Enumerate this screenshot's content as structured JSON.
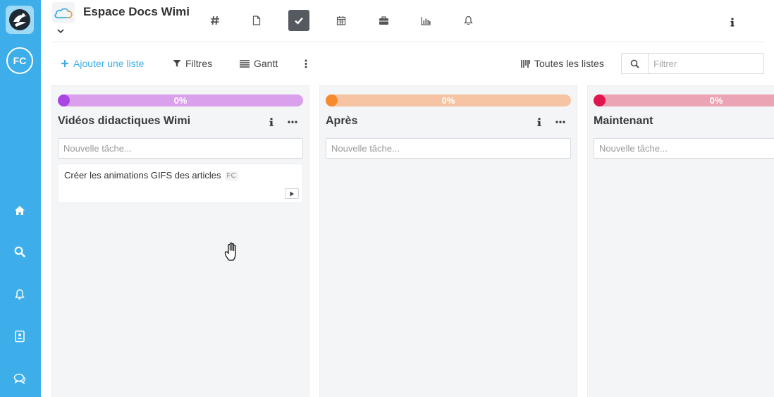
{
  "header": {
    "space_title": "Espace Docs Wimi"
  },
  "sidebar": {
    "avatar_initials": "FC",
    "items": [
      {
        "icon": "home-icon"
      },
      {
        "icon": "search-icon"
      },
      {
        "icon": "bell-icon"
      },
      {
        "icon": "contacts-icon"
      },
      {
        "icon": "chat-icon"
      }
    ]
  },
  "top_tabs": [
    {
      "icon": "hash-icon",
      "active": false
    },
    {
      "icon": "file-icon",
      "active": false
    },
    {
      "icon": "check-icon",
      "active": true
    },
    {
      "icon": "calendar-icon",
      "active": false
    },
    {
      "icon": "briefcase-icon",
      "active": false
    },
    {
      "icon": "chart-icon",
      "active": false
    },
    {
      "icon": "bell-icon",
      "active": false
    }
  ],
  "toolbar": {
    "add_list_label": "Ajouter une liste",
    "filters_label": "Filtres",
    "gantt_label": "Gantt",
    "all_lists_label": "Toutes les listes",
    "search_placeholder": "Filtrer"
  },
  "colors": {
    "sidebar": "#3daee9",
    "accent": "#3daee9"
  },
  "lists": [
    {
      "title": "Vidéos didactiques Wimi",
      "progress_label": "0%",
      "progress": 0,
      "bar_color": "#dba0ec",
      "dot_color": "#a946e3",
      "new_task_placeholder": "Nouvelle tâche...",
      "tasks": [
        {
          "title": "Créer les animations GIFS des articles",
          "assignee": "FC"
        }
      ]
    },
    {
      "title": "Après",
      "progress_label": "0%",
      "progress": 0,
      "bar_color": "#f6c4a2",
      "dot_color": "#f7892f",
      "new_task_placeholder": "Nouvelle tâche...",
      "tasks": []
    },
    {
      "title": "Maintenant",
      "progress_label": "0%",
      "progress": 0,
      "bar_color": "#eaa4b4",
      "dot_color": "#e0164e",
      "new_task_placeholder": "Nouvelle tâche...",
      "tasks": []
    }
  ]
}
